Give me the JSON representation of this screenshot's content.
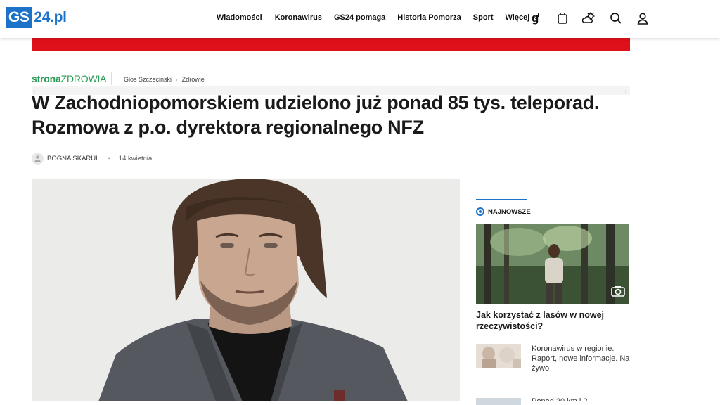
{
  "header": {
    "logo_box": "GS",
    "logo_rest": "24.pl",
    "nav": [
      "Wiadomości",
      "Koronawirus",
      "GS24 pomaga",
      "Historia Pomorza",
      "Sport",
      "Więcej"
    ],
    "icons": [
      "g-icon",
      "tablet-icon",
      "weather-icon",
      "search-icon",
      "user-icon"
    ]
  },
  "breadcrumb": {
    "brand_bold": "strona",
    "brand_rest": "ZDROWIA",
    "items": [
      "Głos Szczeciński",
      "Zdrowie"
    ]
  },
  "article": {
    "title": "W Zachodniopomorskiem udzielono już ponad 85 tys. teleporad. Rozmowa z p.o. dyrektora regionalnego NFZ",
    "author": "BOGNA SKARUL",
    "date": "14 kwietnia"
  },
  "sidebar": {
    "heading": "NAJNOWSZE",
    "featured_title": "Jak korzystać z lasów w nowej rzeczywistości?",
    "item1": "Koronawirus w regionie. Raport, nowe informacje. Na żywo",
    "item2": "Ponad 20 km i 2"
  },
  "colors": {
    "accent": "#1b72c8",
    "banner": "#e0101a",
    "brand_green": "#2a9a55"
  }
}
